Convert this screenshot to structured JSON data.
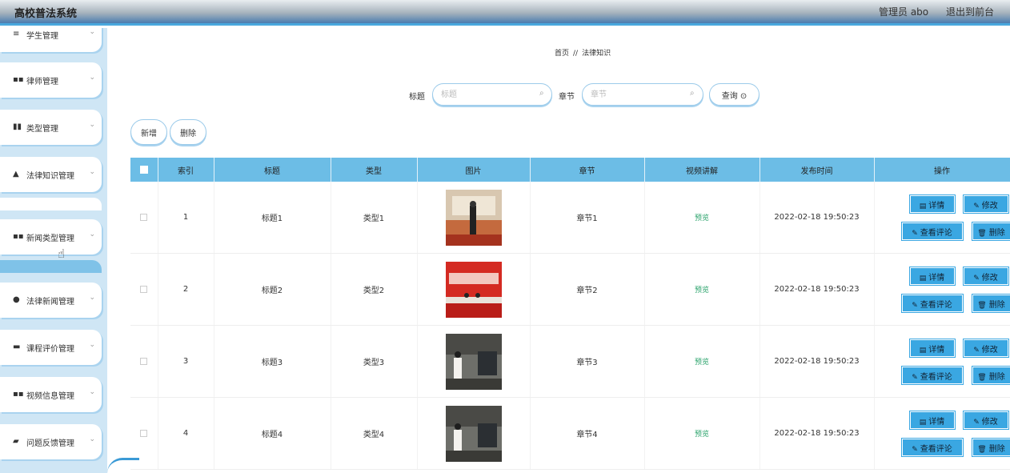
{
  "header": {
    "title": "高校普法系统",
    "user": "管理员 abo",
    "logout": "退出到前台"
  },
  "sidebar": {
    "items": [
      {
        "label": "学生管理",
        "icon": "user-icon",
        "glyph": "≡"
      },
      {
        "label": "律师管理",
        "icon": "grid-icon",
        "glyph": "▪▪"
      },
      {
        "label": "类型管理",
        "icon": "bars-icon",
        "glyph": "▮▮"
      },
      {
        "label": "法律知识管理",
        "icon": "person-icon",
        "glyph": "▲"
      },
      {
        "label": "新闻类型管理",
        "icon": "grid-icon",
        "glyph": "▪▪"
      },
      {
        "label": "法律新闻管理",
        "icon": "person-icon",
        "glyph": "●"
      },
      {
        "label": "课程评价管理",
        "icon": "comment-icon",
        "glyph": "▬"
      },
      {
        "label": "视频信息管理",
        "icon": "grid-icon",
        "glyph": "▪▪"
      },
      {
        "label": "问题反馈管理",
        "icon": "folder-icon",
        "glyph": "▰"
      }
    ]
  },
  "breadcrumb": {
    "home": "首页",
    "sep": "//",
    "current": "法律知识"
  },
  "search": {
    "title_label": "标题",
    "title_placeholder": "标题",
    "chapter_label": "章节",
    "chapter_placeholder": "章节",
    "query_label": "查询",
    "query_icon": "⊙"
  },
  "actions": {
    "add": "新增",
    "delete": "删除"
  },
  "table": {
    "headers": [
      "索引",
      "标题",
      "类型",
      "图片",
      "章节",
      "视频讲解",
      "发布时间",
      "操作"
    ],
    "rows": [
      {
        "index": "1",
        "title": "标题1",
        "type": "类型1",
        "chapter": "章节1",
        "video": "预览",
        "time": "2022-02-18 19:50:23"
      },
      {
        "index": "2",
        "title": "标题2",
        "type": "类型2",
        "chapter": "章节2",
        "video": "预览",
        "time": "2022-02-18 19:50:23"
      },
      {
        "index": "3",
        "title": "标题3",
        "type": "类型3",
        "chapter": "章节3",
        "video": "预览",
        "time": "2022-02-18 19:50:23"
      },
      {
        "index": "4",
        "title": "标题4",
        "type": "类型4",
        "chapter": "章节4",
        "video": "预览",
        "time": "2022-02-18 19:50:23"
      }
    ],
    "row_actions": {
      "detail": "详情",
      "edit": "修改",
      "comments": "查看评论",
      "delete": "删除"
    }
  },
  "colors": {
    "accent": "#3aa7e2",
    "header_bg": "#6cbde6",
    "sidebar_bg": "#cfe6f5",
    "preview_text": "#2aa36b"
  }
}
